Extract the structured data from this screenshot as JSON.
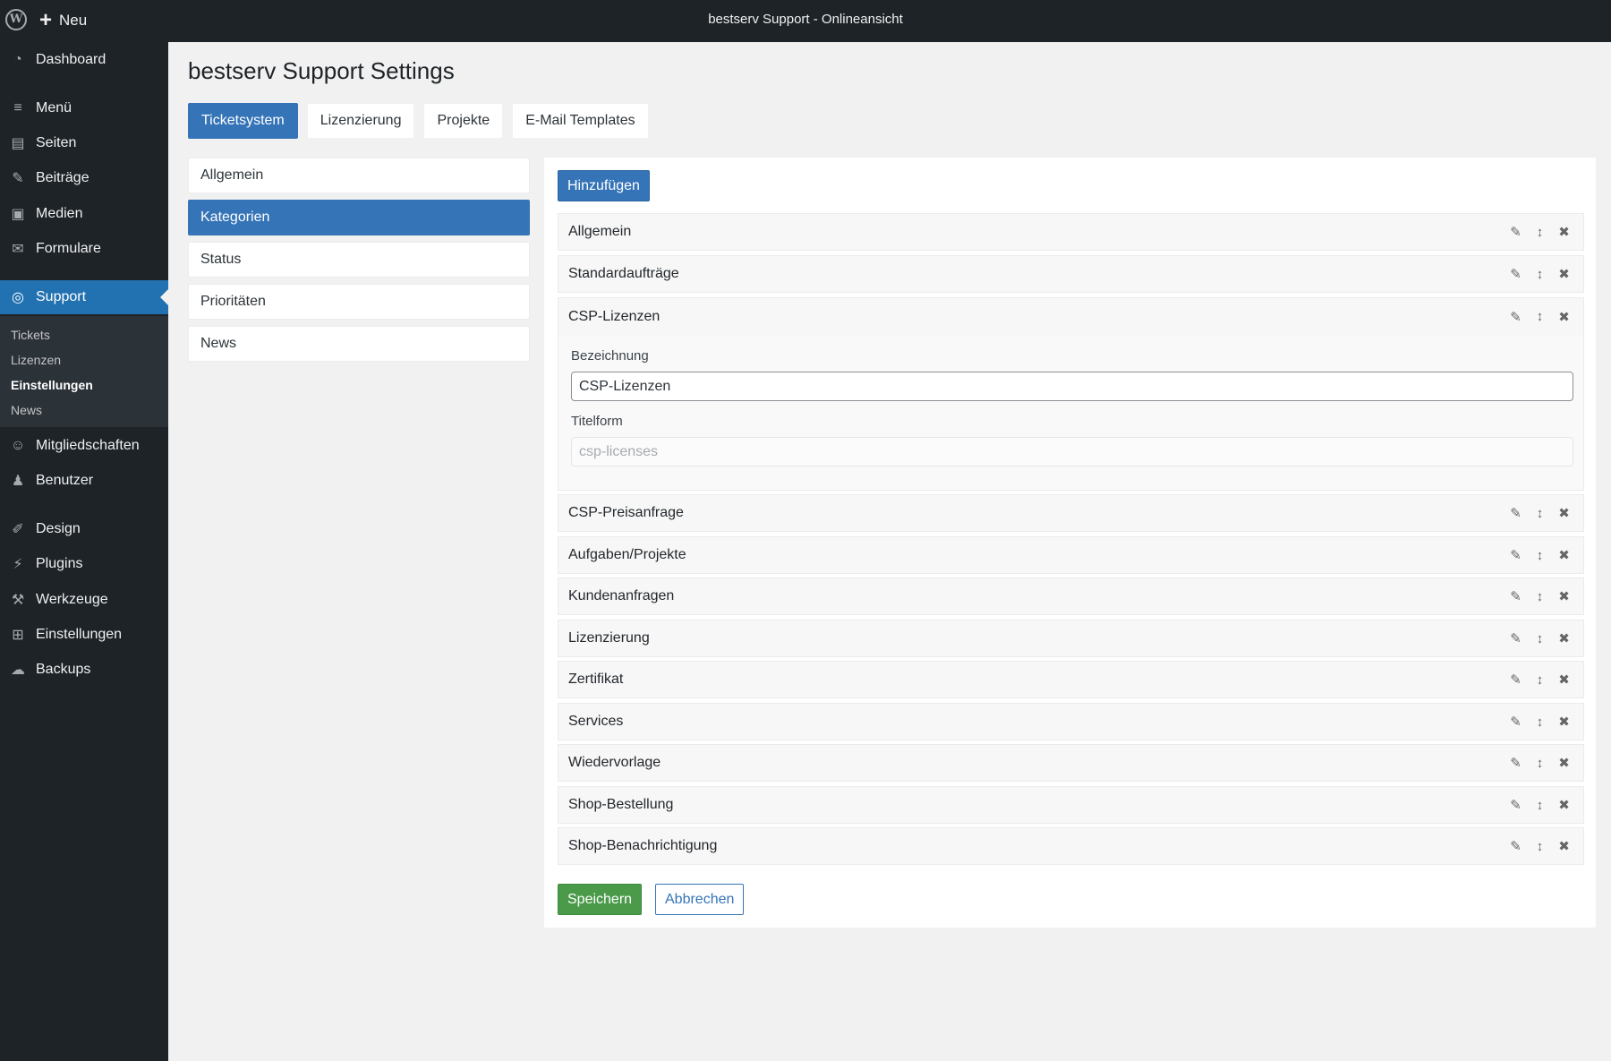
{
  "adminbar": {
    "wp_logo": "W",
    "new_icon": "+",
    "new_label": "Neu",
    "site_title": "bestserv Support - Onlineansicht"
  },
  "sidebar": {
    "items": [
      {
        "icon": "◔",
        "icon_name": "dashboard-icon",
        "label": "Dashboard"
      },
      {
        "icon": "≡",
        "icon_name": "menu-icon",
        "label": "Menü"
      },
      {
        "icon": "▤",
        "icon_name": "pages-icon",
        "label": "Seiten"
      },
      {
        "icon": "✎",
        "icon_name": "pin-icon",
        "label": "Beiträge"
      },
      {
        "icon": "▣",
        "icon_name": "media-icon",
        "label": "Medien"
      },
      {
        "icon": "✉",
        "icon_name": "mail-icon",
        "label": "Formulare"
      },
      {
        "icon": "◎",
        "icon_name": "headset-icon",
        "label": "Support"
      },
      {
        "icon": "☺",
        "icon_name": "groups-icon",
        "label": "Mitgliedschaften"
      },
      {
        "icon": "♟",
        "icon_name": "user-icon",
        "label": "Benutzer"
      },
      {
        "icon": "✐",
        "icon_name": "brush-icon",
        "label": "Design"
      },
      {
        "icon": "⚡",
        "icon_name": "plugin-icon",
        "label": "Plugins"
      },
      {
        "icon": "⚒",
        "icon_name": "wrench-icon",
        "label": "Werkzeuge"
      },
      {
        "icon": "⊞",
        "icon_name": "settings-icon",
        "label": "Einstellungen"
      },
      {
        "icon": "☁",
        "icon_name": "cloud-icon",
        "label": "Backups"
      }
    ],
    "submenu": [
      "Tickets",
      "Lizenzen",
      "Einstellungen",
      "News"
    ]
  },
  "main": {
    "title": "bestserv Support Settings",
    "tabs": [
      "Ticketsystem",
      "Lizenzierung",
      "Projekte",
      "E-Mail Templates"
    ],
    "subnav": [
      "Allgemein",
      "Kategorien",
      "Status",
      "Prioritäten",
      "News"
    ],
    "add_label": "Hinzufügen",
    "categories": [
      "Allgemein",
      "Standardaufträge",
      "CSP-Lizenzen",
      "CSP-Preisanfrage",
      "Aufgaben/Projekte",
      "Kundenanfragen",
      "Lizenzierung",
      "Zertifikat",
      "Services",
      "Wiedervorlage",
      "Shop-Bestellung",
      "Shop-Benachrichtigung"
    ],
    "edit_form": {
      "bezeichnung_label": "Bezeichnung",
      "bezeichnung_value": "CSP-Lizenzen",
      "titelform_label": "Titelform",
      "titelform_placeholder": "csp-licenses"
    },
    "save_label": "Speichern",
    "cancel_label": "Abbrechen"
  },
  "colors": {
    "primary": "#3574b7",
    "sidebar_bg": "#1d2327",
    "sidebar_active": "#2271b1",
    "save_green": "#4a9a4a"
  }
}
